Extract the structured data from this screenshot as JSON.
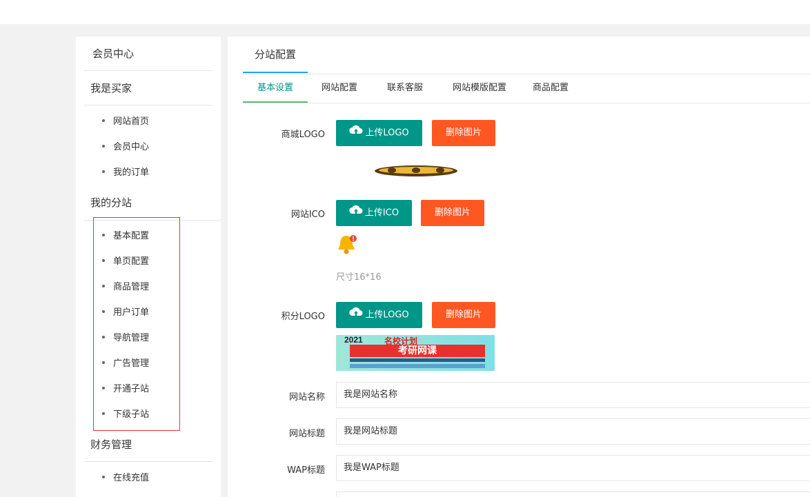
{
  "sidebar": {
    "member_center": "会员中心",
    "sections": [
      {
        "title": "我是买家",
        "items": [
          "网站首页",
          "会员中心",
          "我的订单"
        ]
      },
      {
        "title": "我的分站",
        "items": [
          "基本配置",
          "单页配置",
          "商品管理",
          "用户订单",
          "导航管理",
          "广告管理",
          "开通子站",
          "下级子站"
        ]
      },
      {
        "title": "财务管理",
        "items": [
          "在线充值"
        ]
      }
    ]
  },
  "main": {
    "title": "分站配置",
    "tabs": [
      "基本设置",
      "网站配置",
      "联系客服",
      "网站模版配置",
      "商品配置"
    ],
    "active_tab": 0,
    "mall_logo": {
      "label": "商城LOGO",
      "upload": "上传LOGO",
      "delete": "删除图片"
    },
    "site_ico": {
      "label": "网站ICO",
      "upload": "上传ICO",
      "delete": "删除图片",
      "hint": "尺寸16*16"
    },
    "points_logo": {
      "label": "积分LOGO",
      "upload": "上传LOGO",
      "delete": "删除图片",
      "banner": {
        "year": "2021",
        "plan": "名校计划",
        "title": "考研网课"
      }
    },
    "site_name": {
      "label": "网站名称",
      "value": "我是网站名称"
    },
    "site_title": {
      "label": "网站标题",
      "value": "我是网站标题"
    },
    "wap_title": {
      "label": "WAP标题",
      "value": "我是WAP标题"
    }
  },
  "colors": {
    "teal": "#009688",
    "orange": "#ff5722",
    "tab_active": "#009688",
    "title_underline": "#1e9fff",
    "highlight": "#e33333"
  }
}
